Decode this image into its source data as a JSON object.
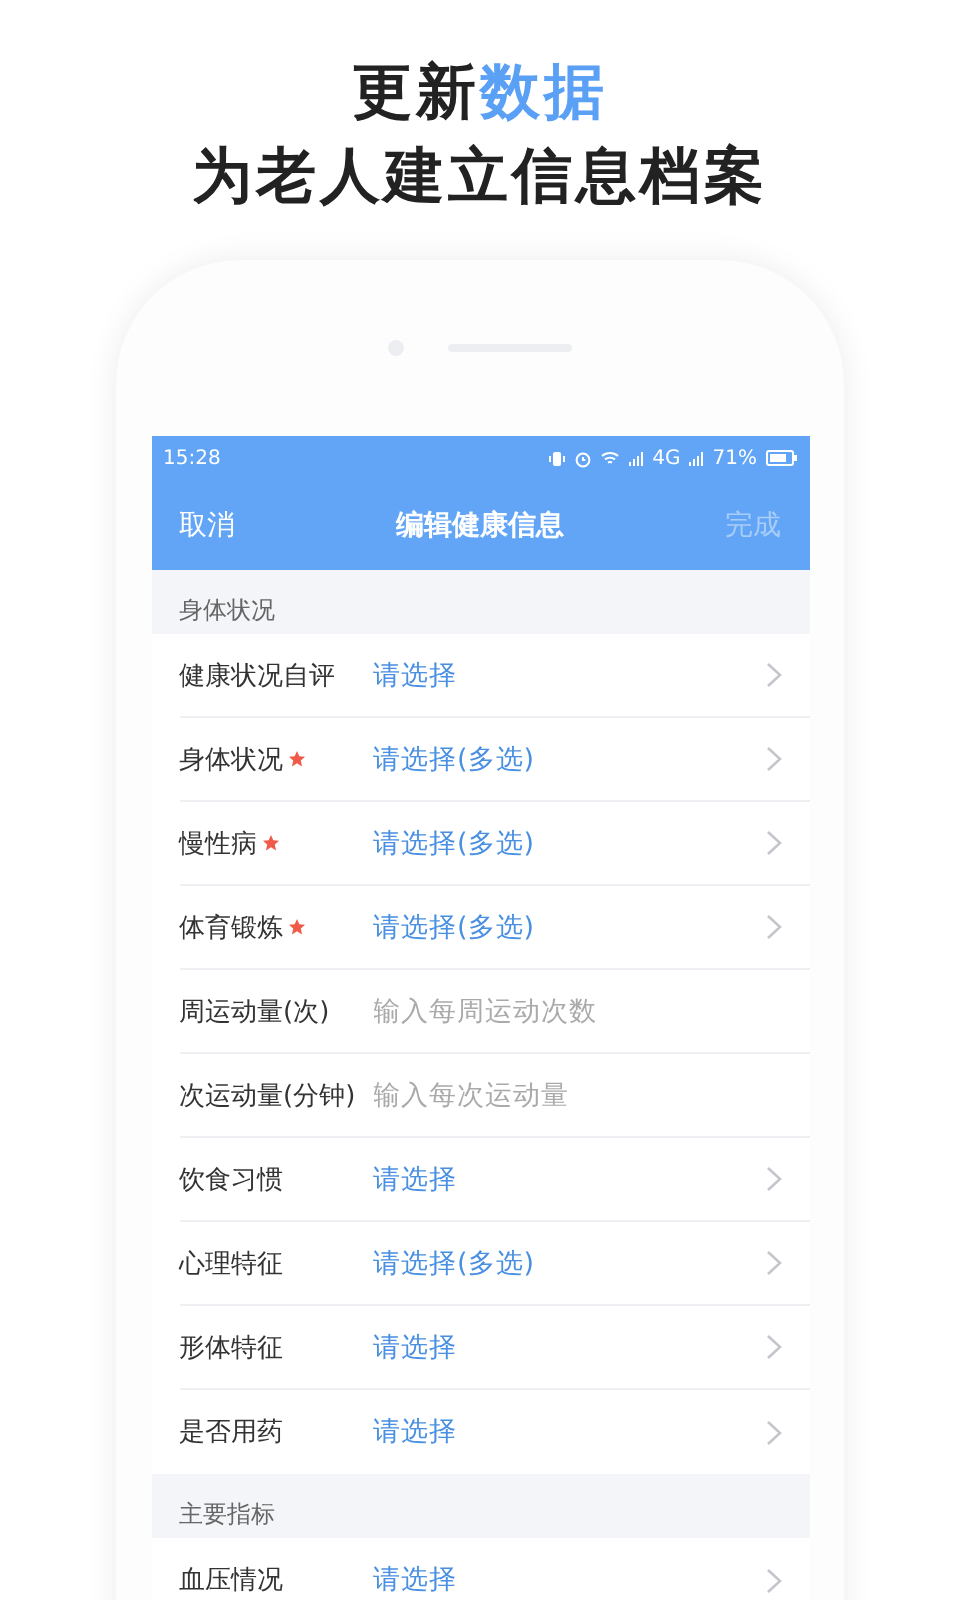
{
  "headline": {
    "line1": [
      {
        "text": "更新",
        "highlight": false
      },
      {
        "text": "数据",
        "highlight": true
      }
    ],
    "line2": "为老人建立信息档案"
  },
  "status_bar": {
    "time": "15:28",
    "network": "4G",
    "battery": "71%"
  },
  "nav": {
    "left": "取消",
    "title": "编辑健康信息",
    "right": "完成",
    "right_disabled": true
  },
  "sections": [
    {
      "title": "身体状况",
      "rows": [
        {
          "label": "健康状况自评",
          "required": false,
          "kind": "select",
          "value": "请选择"
        },
        {
          "label": "身体状况",
          "required": true,
          "kind": "select",
          "value": "请选择(多选)"
        },
        {
          "label": "慢性病",
          "required": true,
          "kind": "select",
          "value": "请选择(多选)"
        },
        {
          "label": "体育锻炼",
          "required": true,
          "kind": "select",
          "value": "请选择(多选)"
        },
        {
          "label": "周运动量(次)",
          "required": false,
          "kind": "input",
          "placeholder": "输入每周运动次数"
        },
        {
          "label": "次运动量(分钟)",
          "required": false,
          "kind": "input",
          "placeholder": "输入每次运动量"
        },
        {
          "label": "饮食习惯",
          "required": false,
          "kind": "select",
          "value": "请选择"
        },
        {
          "label": "心理特征",
          "required": false,
          "kind": "select",
          "value": "请选择(多选)"
        },
        {
          "label": "形体特征",
          "required": false,
          "kind": "select",
          "value": "请选择"
        },
        {
          "label": "是否用药",
          "required": false,
          "kind": "select",
          "value": "请选择"
        }
      ]
    },
    {
      "title": "主要指标",
      "rows": [
        {
          "label": "血压情况",
          "required": false,
          "kind": "select",
          "value": "请选择"
        }
      ]
    }
  ]
}
